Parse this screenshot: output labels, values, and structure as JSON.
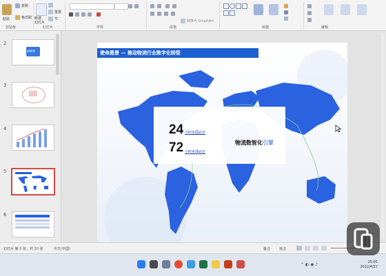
{
  "ribbon": {
    "clipboard_group": "剪贴板",
    "paste_label": "粘贴",
    "format_painter_label": "格式刷",
    "copy_label": "复制",
    "slides_group": "幻灯片",
    "new_slide_label": "新建\n幻灯片",
    "reset_label": "重置",
    "section_label": "节",
    "font_group": "字体",
    "paragraph_group": "段落",
    "convert_smartart_label": "转换为 SmartArt",
    "drawing_group": "绘图",
    "editing_group": "编辑"
  },
  "thumbnails": [
    {
      "num": "2",
      "label": "金融科技"
    },
    {
      "num": "3",
      "label": ""
    },
    {
      "num": "4",
      "label": ""
    },
    {
      "num": "5",
      "label": ""
    },
    {
      "num": "6",
      "label": ""
    }
  ],
  "slide": {
    "title": "使命愿景 — 推动物流行业数字化转型",
    "stat1_number": "24",
    "stat1_caption": "小时全国必达",
    "stat2_number": "72",
    "stat2_caption": "小时全球必达",
    "slogan_main": "物流数智化",
    "slogan_highlight": "引擎"
  },
  "statusbar": {
    "slide_info": "幻灯片 第 5 张，共 20 张",
    "language": "中文(中国)",
    "notes_label": "备注",
    "comments_label": "批注"
  },
  "taskbar": {
    "time": "15:05",
    "date": "2022/4/27"
  },
  "colors": {
    "accent": "#1c5fd0",
    "map_land": "#2a62e0",
    "active_thumb_border": "#d14a42"
  }
}
